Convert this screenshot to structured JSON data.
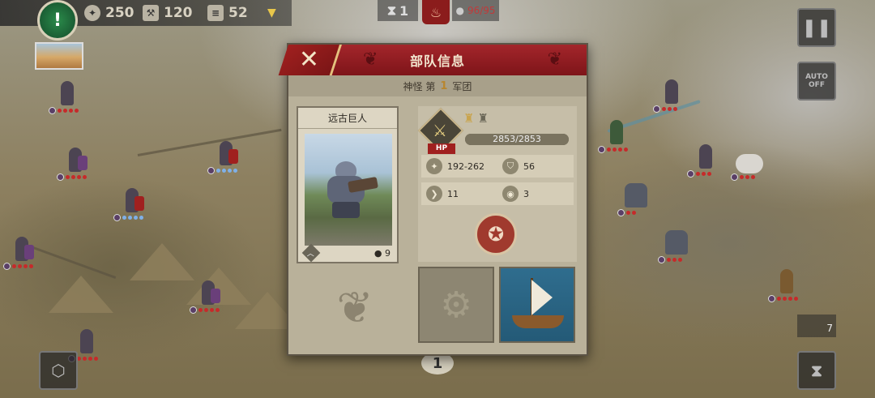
{
  "hud": {
    "alert_glyph": "!",
    "resources": [
      {
        "name": "gold",
        "value": "250"
      },
      {
        "name": "hammer",
        "value": "120"
      },
      {
        "name": "scroll",
        "value": "52"
      }
    ],
    "turn": "1",
    "population": "96/95"
  },
  "modal": {
    "title": "部队信息",
    "subtitle_prefix": "神怪 第",
    "subtitle_number": "1",
    "subtitle_suffix": "军团",
    "close_glyph": "✕",
    "card": {
      "name": "远古巨人",
      "count": "9"
    },
    "stats": {
      "hp_tag": "HP",
      "hp_text": "2853/2853",
      "hp_fraction": 1.0,
      "attack": "192-262",
      "defense": "56",
      "mobility": "11",
      "vision": "3"
    }
  },
  "side": {
    "auto_label_1": "AUTO",
    "auto_label_2": "OFF",
    "counter": "7"
  },
  "bottom_hex": "1",
  "colors": {
    "header_red": "#a3262b",
    "panel_tan": "#b9b19a",
    "hp_red": "#a0201f",
    "gold_accent": "#c9a44e"
  }
}
